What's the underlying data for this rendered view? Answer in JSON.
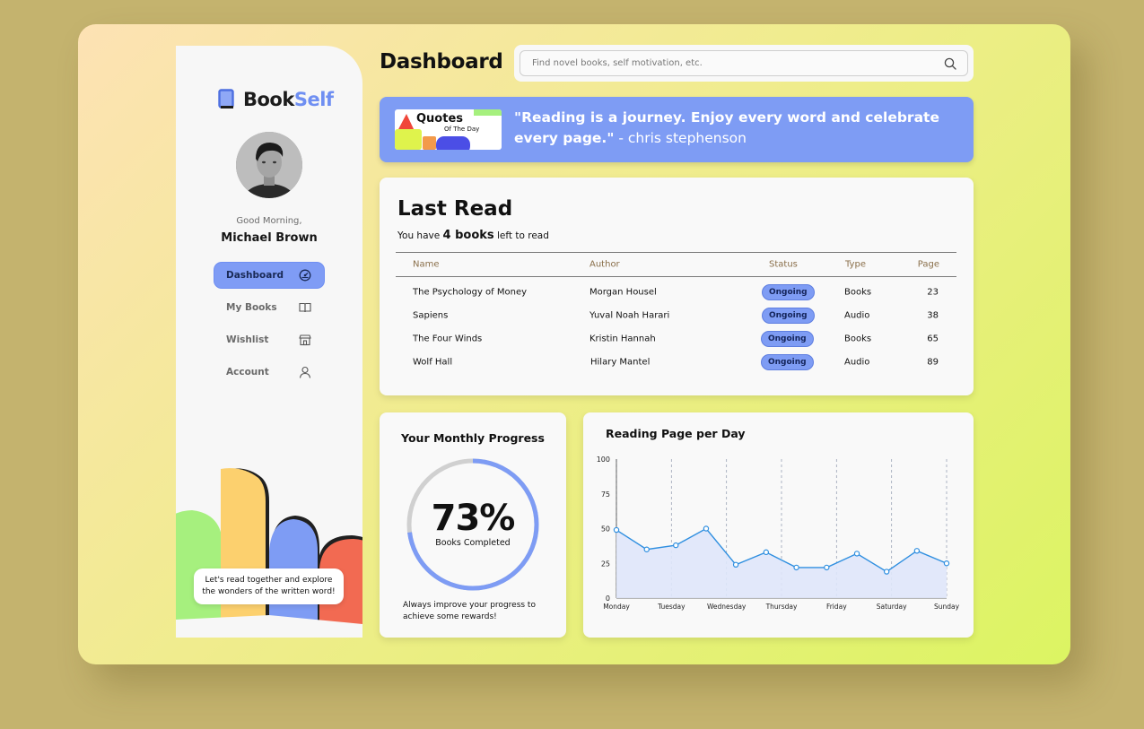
{
  "app": {
    "brand_prefix": "Book",
    "brand_accent": "Self"
  },
  "sidebar": {
    "greeting": "Good Morning,",
    "user_name": "Michael Brown",
    "items": [
      {
        "label": "Dashboard",
        "icon": "dashboard-icon",
        "active": true
      },
      {
        "label": "My Books",
        "icon": "open-book-icon",
        "active": false
      },
      {
        "label": "Wishlist",
        "icon": "store-icon",
        "active": false
      },
      {
        "label": "Account",
        "icon": "user-icon",
        "active": false
      }
    ],
    "bubble_text": "Let's read together and explore the wonders of the written word!"
  },
  "header": {
    "title": "Dashboard",
    "search_placeholder": "Find novel books, self motivation, etc."
  },
  "quote": {
    "badge_title": "Quotes",
    "badge_subtitle": "Of The Day",
    "text": "\"Reading is a journey. Enjoy every word and celebrate every page.\"",
    "author": " - chris stephenson"
  },
  "last_read": {
    "title": "Last Read",
    "sub_prefix": "You have ",
    "sub_count": "4 books",
    "sub_suffix": " left to read",
    "columns": [
      "Name",
      "Author",
      "Status",
      "Type",
      "Page"
    ],
    "rows": [
      {
        "name": "The Psychology of Money",
        "author": "Morgan Housel",
        "status": "Ongoing",
        "type": "Books",
        "page": "23"
      },
      {
        "name": "Sapiens",
        "author": "Yuval Noah Harari",
        "status": "Ongoing",
        "type": "Audio",
        "page": "38"
      },
      {
        "name": "The Four Winds",
        "author": "Kristin Hannah",
        "status": "Ongoing",
        "type": "Books",
        "page": "65"
      },
      {
        "name": "Wolf Hall",
        "author": "Hilary Mantel",
        "status": "Ongoing",
        "type": "Audio",
        "page": "89"
      }
    ]
  },
  "progress": {
    "title": "Your Monthly Progress",
    "value": "73%",
    "fraction": 0.73,
    "label": "Books Completed",
    "note": "Always improve your progress to achieve some rewards!"
  },
  "chart_data": {
    "type": "line",
    "title": "Reading Page per Day",
    "categories": [
      "Monday",
      "Tuesday",
      "Wednesday",
      "Thursday",
      "Friday",
      "Saturday",
      "Sunday"
    ],
    "x": [
      0,
      0.5,
      1,
      1.5,
      2,
      2.5,
      3,
      3.5,
      4,
      4.5,
      5,
      5.5,
      6
    ],
    "values": [
      49,
      35,
      38,
      50,
      24,
      33,
      22,
      22,
      32,
      19,
      34,
      25
    ],
    "points": [
      {
        "x": 0,
        "y": 49
      },
      {
        "x": 0.55,
        "y": 35
      },
      {
        "x": 1.08,
        "y": 38
      },
      {
        "x": 1.63,
        "y": 50
      },
      {
        "x": 2.17,
        "y": 24
      },
      {
        "x": 2.72,
        "y": 33
      },
      {
        "x": 3.27,
        "y": 22
      },
      {
        "x": 3.82,
        "y": 22
      },
      {
        "x": 4.37,
        "y": 32
      },
      {
        "x": 4.91,
        "y": 19
      },
      {
        "x": 5.46,
        "y": 34
      },
      {
        "x": 6,
        "y": 25
      }
    ],
    "yticks": [
      0,
      25,
      50,
      75,
      100
    ],
    "ylim": [
      0,
      100
    ],
    "grid": "vertical-dashed",
    "colors": {
      "line": "#2f8fe0",
      "fill": "#dfe6fa"
    }
  },
  "colors": {
    "accent": "#7e9cf4",
    "brand": "#6f8ff2"
  }
}
